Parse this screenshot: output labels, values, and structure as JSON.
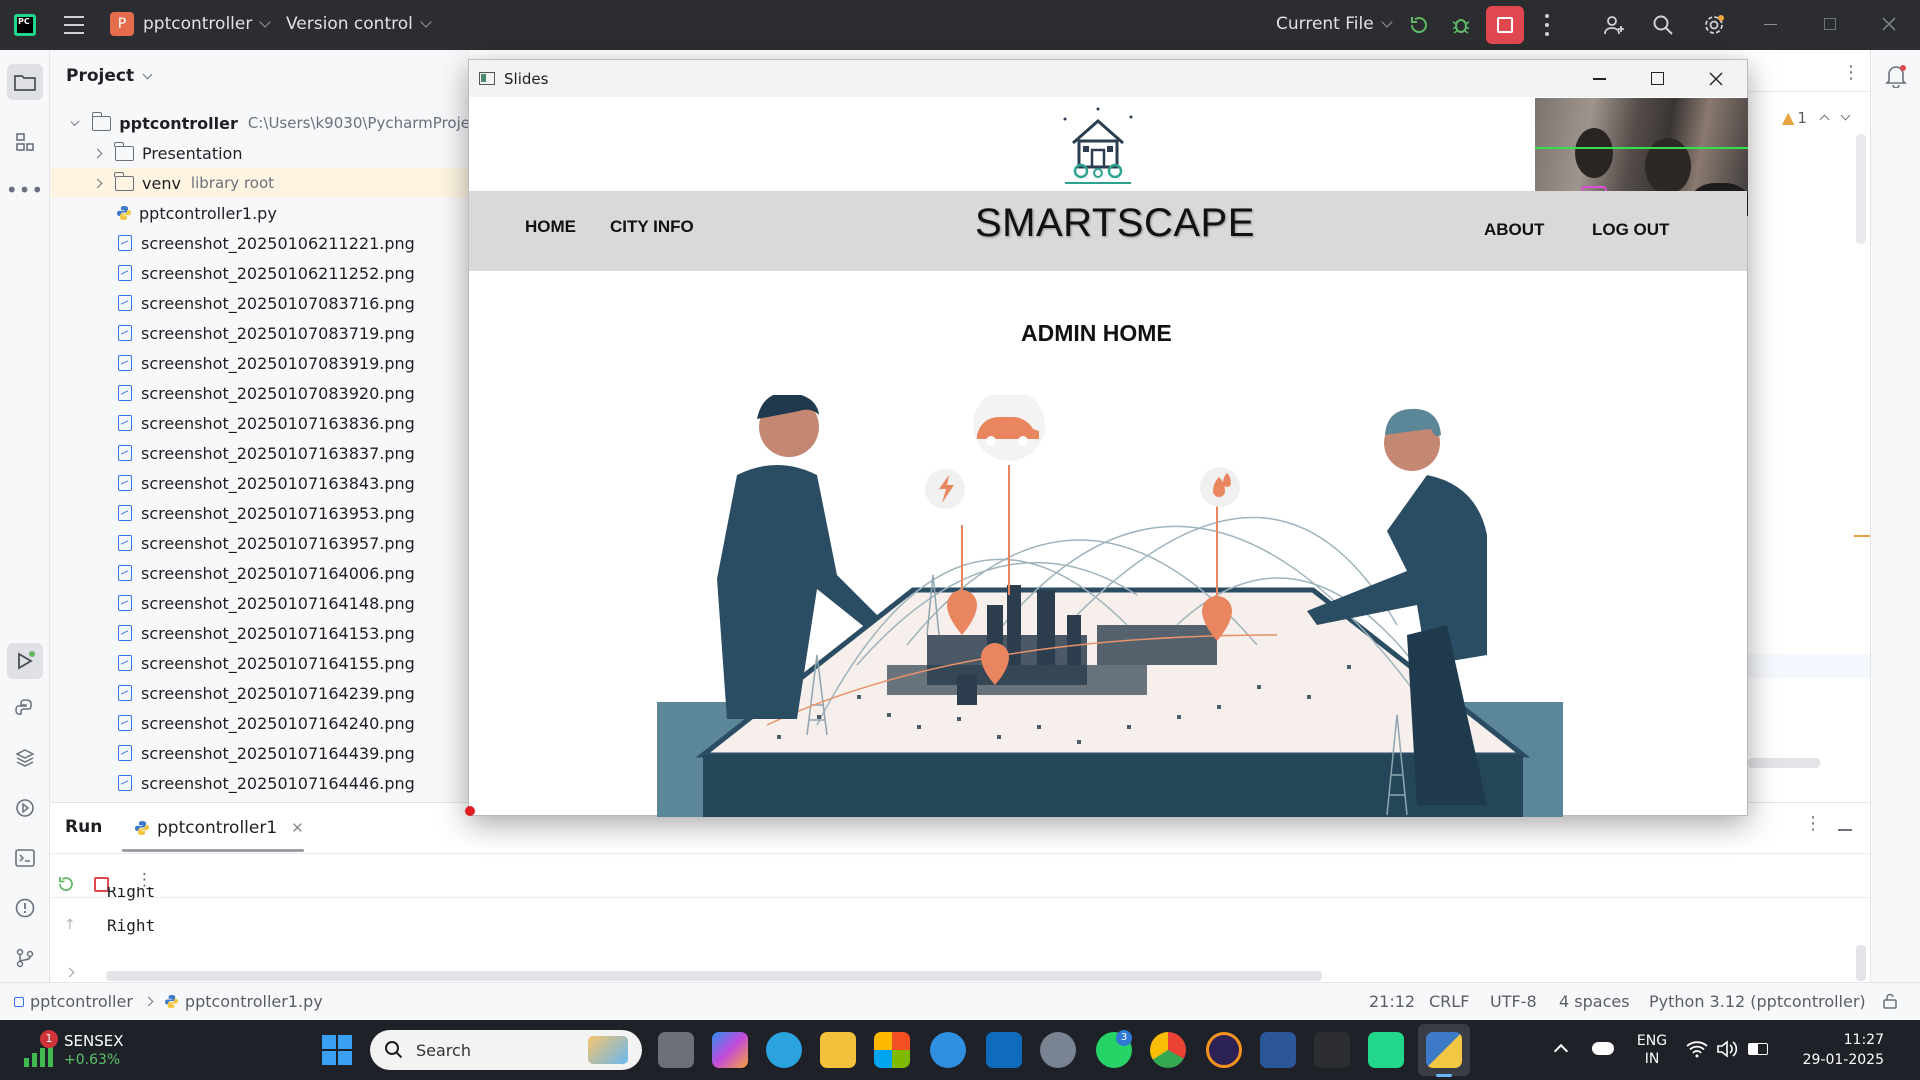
{
  "ide": {
    "project_name": "pptcontroller",
    "project_initial": "P",
    "vcs_label": "Version control",
    "run_config": "Current File",
    "colors": {
      "accent": "#3574f0",
      "stop": "#e0484f",
      "run": "#5fb865",
      "dark_bar": "#2b2d30"
    }
  },
  "project_panel": {
    "title": "Project",
    "root": {
      "name": "pptcontroller",
      "path": "C:\\Users\\k9030\\PycharmProje"
    },
    "folders": [
      {
        "name": "Presentation",
        "note": ""
      },
      {
        "name": "venv",
        "note": "library root"
      }
    ],
    "py_file": "pptcontroller1.py",
    "files": [
      "screenshot_20250106211221.png",
      "screenshot_20250106211252.png",
      "screenshot_20250107083716.png",
      "screenshot_20250107083719.png",
      "screenshot_20250107083919.png",
      "screenshot_20250107083920.png",
      "screenshot_20250107163836.png",
      "screenshot_20250107163837.png",
      "screenshot_20250107163843.png",
      "screenshot_20250107163953.png",
      "screenshot_20250107163957.png",
      "screenshot_20250107164006.png",
      "screenshot_20250107164148.png",
      "screenshot_20250107164153.png",
      "screenshot_20250107164155.png",
      "screenshot_20250107164239.png",
      "screenshot_20250107164240.png",
      "screenshot_20250107164439.png",
      "screenshot_20250107164446.png"
    ]
  },
  "editor": {
    "warning_count": "1"
  },
  "run_panel": {
    "title": "Run",
    "tab": "pptcontroller1",
    "output": [
      "Right",
      "Right"
    ]
  },
  "statusbar": {
    "crumb_project": "pptcontroller",
    "crumb_file": "pptcontroller1.py",
    "position": "21:12",
    "line_sep": "CRLF",
    "encoding": "UTF-8",
    "indent": "4 spaces",
    "interpreter": "Python 3.12 (pptcontroller)"
  },
  "slides_window": {
    "title": "Slides",
    "site": {
      "nav_left": [
        "HOME",
        "CITY INFO"
      ],
      "brand": "SMARTSCAPE",
      "nav_right": [
        "ABOUT",
        "LOG OUT"
      ],
      "heading": "ADMIN HOME"
    }
  },
  "taskbar": {
    "widget_name": "SENSEX",
    "widget_value": "+0.63%",
    "widget_badge": "1",
    "search_placeholder": "Search",
    "whatsapp_badge": "3",
    "lang_top": "ENG",
    "lang_bottom": "IN",
    "time": "11:27",
    "date": "29-01-2025"
  }
}
